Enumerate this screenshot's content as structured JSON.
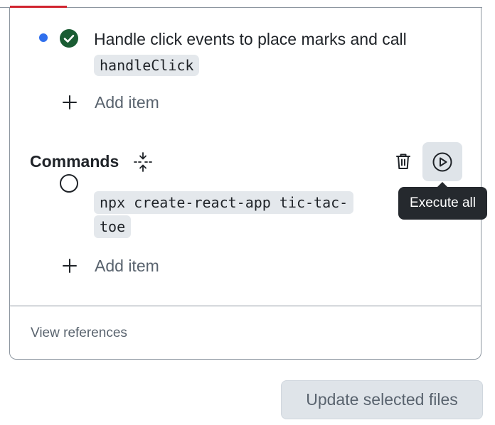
{
  "task": {
    "text_before": "Handle click events to place marks and call ",
    "code": "handleClick",
    "status": "completed",
    "status_icon": "check-circle-icon",
    "indicator_color": "#2f6fed",
    "check_color": "#1a7f37"
  },
  "tasks_add_item_label": "Add item",
  "commands": {
    "title": "Commands",
    "fold_icon": "fold-icon",
    "delete_icon": "trash-icon",
    "execute_icon": "play-icon",
    "execute_tooltip": "Execute all",
    "items": [
      {
        "code": "npx create-react-app tic-tac-toe",
        "status_icon": "circle-icon"
      }
    ],
    "add_item_label": "Add item"
  },
  "footer": {
    "view_references_label": "View references"
  },
  "update_button_label": "Update selected files",
  "colors": {
    "accent_red": "#d1242f",
    "border": "#8c959f",
    "tooltip_bg": "#25292e",
    "button_bg": "#dfe4e9"
  }
}
